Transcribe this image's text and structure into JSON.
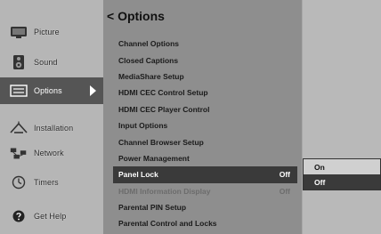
{
  "header": {
    "title": "< Options"
  },
  "sidebar": {
    "items": [
      {
        "label": "Picture",
        "icon": "picture-icon"
      },
      {
        "label": "Sound",
        "icon": "speaker-icon"
      },
      {
        "label": "Options",
        "icon": "options-icon",
        "selected": true
      },
      {
        "label": "Installation",
        "icon": "installation-icon"
      },
      {
        "label": "Network",
        "icon": "network-icon"
      },
      {
        "label": "Timers",
        "icon": "timer-icon"
      },
      {
        "label": "Get Help",
        "icon": "help-icon"
      }
    ]
  },
  "menu": {
    "items": [
      {
        "label": "Channel Options",
        "value": ""
      },
      {
        "label": "Closed Captions",
        "value": ""
      },
      {
        "label": "MediaShare Setup",
        "value": ""
      },
      {
        "label": "HDMI CEC Control Setup",
        "value": ""
      },
      {
        "label": "HDMI CEC Player Control",
        "value": ""
      },
      {
        "label": "Input Options",
        "value": ""
      },
      {
        "label": "Channel Browser Setup",
        "value": ""
      },
      {
        "label": "Power Management",
        "value": ""
      },
      {
        "label": "Panel Lock",
        "value": "Off",
        "state": "highlight"
      },
      {
        "label": "HDMI Information Display",
        "value": "Off",
        "state": "disabled"
      },
      {
        "label": "Parental PIN Setup",
        "value": ""
      },
      {
        "label": "Parental Control and Locks",
        "value": ""
      }
    ]
  },
  "submenu": {
    "options": [
      {
        "label": "On"
      },
      {
        "label": "Off",
        "selected": true
      }
    ]
  }
}
